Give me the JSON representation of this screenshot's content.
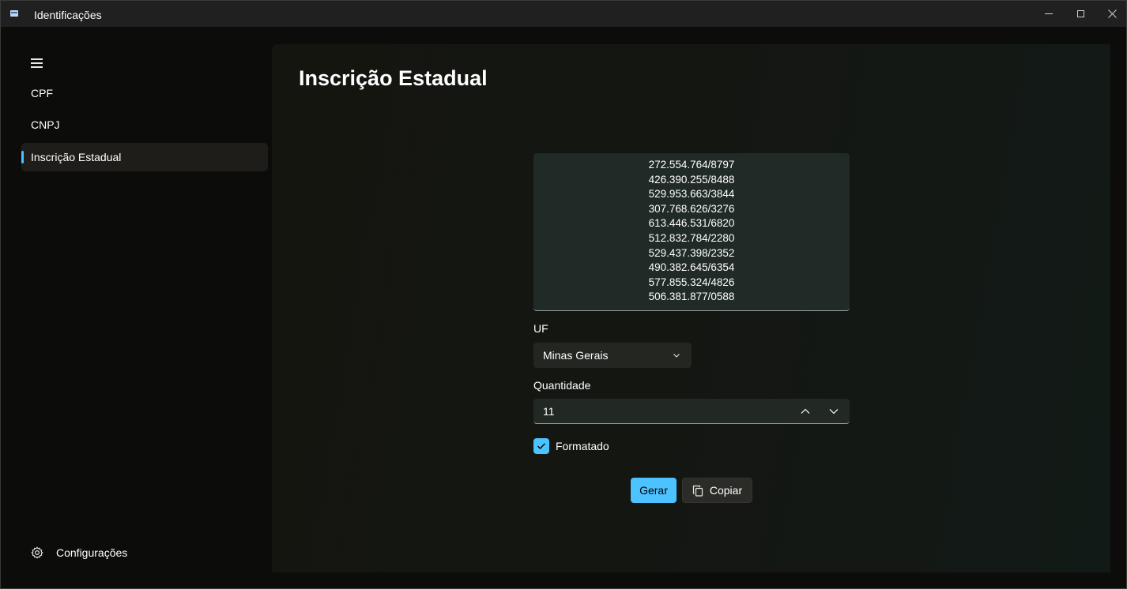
{
  "window": {
    "title": "Identificações"
  },
  "nav": {
    "items": [
      {
        "label": "CPF",
        "selected": false
      },
      {
        "label": "CNPJ",
        "selected": false
      },
      {
        "label": "Inscrição Estadual",
        "selected": true
      }
    ],
    "settings_label": "Configurações"
  },
  "page": {
    "title": "Inscrição Estadual",
    "results": [
      "272.554.764/8797",
      "426.390.255/8488",
      "529.953.663/3844",
      "307.768.626/3276",
      "613.446.531/6820",
      "512.832.784/2280",
      "529.437.398/2352",
      "490.382.645/6354",
      "577.855.324/4826",
      "506.381.877/0588"
    ],
    "uf_label": "UF",
    "uf_value": "Minas Gerais",
    "quantity_label": "Quantidade",
    "quantity_value": "11",
    "formatted_label": "Formatado",
    "formatted_checked": true,
    "generate_label": "Gerar",
    "copy_label": "Copiar"
  },
  "colors": {
    "accent": "#4cc2ff",
    "background": "#0c0c0a",
    "content_background": "#141612"
  },
  "icons": {
    "menu": "hamburger-icon",
    "settings": "gear-icon",
    "dropdown": "chevron-down-icon",
    "copy": "copy-icon",
    "check": "check-icon"
  }
}
